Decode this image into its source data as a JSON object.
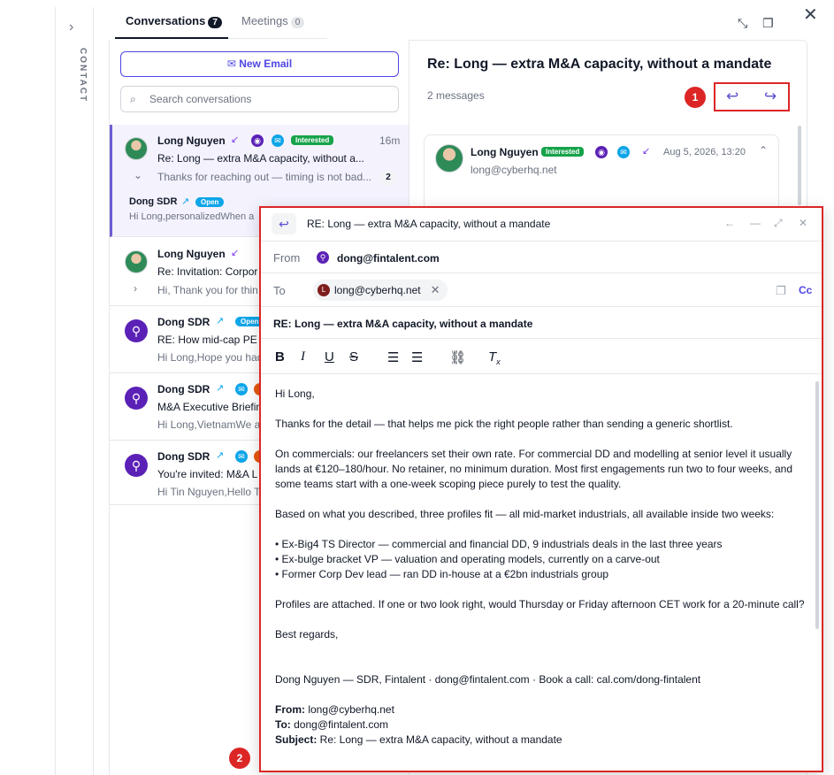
{
  "contact_rail": {
    "label": "CONTACT"
  },
  "tabs": [
    {
      "label": "Conversations",
      "count": "7"
    },
    {
      "label": "Meetings",
      "count": "0"
    }
  ],
  "list": {
    "new_email_label": "New Email",
    "search_placeholder": "Search conversations",
    "conversations": [
      {
        "name": "Long Nguyen",
        "tag": "Interested",
        "time": "16m",
        "subject": "Re: Long — extra M&A capacity, without a...",
        "preview": "Thanks for reaching out — timing is not bad...",
        "count": "2",
        "sub_name": "Dong SDR",
        "sub_badge": "Open",
        "sub_preview": "Hi Long,personalizedWhen a"
      },
      {
        "name": "Long Nguyen",
        "subject": "Re: Invitation: Corpor",
        "preview": "Hi, Thank you for thin"
      },
      {
        "name": "Dong SDR",
        "badge": "Open",
        "subject": "RE: How mid-cap PE",
        "preview": "Hi Long,Hope you had"
      },
      {
        "name": "Dong SDR",
        "subject": "M&A Executive Briefin",
        "preview": "Hi Long,VietnamWe a"
      },
      {
        "name": "Dong SDR",
        "subject": "You're invited: M&A L",
        "preview": "Hi Tin Nguyen,Hello T"
      }
    ]
  },
  "thread": {
    "title": "Re: Long — extra M&A capacity, without a mandate",
    "message_count": "2 messages",
    "annotation_1": "1",
    "message": {
      "sender": "Long Nguyen",
      "tag": "Interested",
      "date": "Aug 5, 2026, 13:20",
      "email": "long@cyberhq.net"
    }
  },
  "compose": {
    "title": "RE: Long — extra M&A capacity, without a mandate",
    "from_label": "From",
    "from_value": "dong@fintalent.com",
    "to_label": "To",
    "to_value": "long@cyberhq.net",
    "to_avatar": "L",
    "cc_label": "Cc",
    "subject": "RE: Long — extra M&A capacity, without a mandate",
    "annotation_2": "2",
    "body": {
      "greeting": "Hi Long,",
      "p1": "Thanks for the detail — that helps me pick the right people rather than sending a generic shortlist.",
      "p2": "On commercials: our freelancers set their own rate. For commercial DD and modelling at senior level it usually lands at €120–180/hour. No retainer, no minimum duration. Most first engagements run two to four weeks, and some teams start with a one-week scoping piece purely to test the quality.",
      "p3": "Based on what you described, three profiles fit — all mid-market industrials, all available inside two weeks:",
      "bullets": [
        "• Ex-Big4 TS Director — commercial and financial DD, 9 industrials deals in the last three years",
        "• Ex-bulge bracket VP — valuation and operating models, currently on a carve-out",
        "• Former Corp Dev lead — ran DD in-house at a €2bn industrials group"
      ],
      "p4": "Profiles are attached. If one or two look right, would Thursday or Friday afternoon CET work for a 20-minute call?",
      "closing": "Best regards,",
      "signature": "Dong Nguyen — SDR, Fintalent · dong@fintalent.com · Book a call: cal.com/dong-fintalent",
      "quoted_from_label": "From:",
      "quoted_from": " long@cyberhq.net",
      "quoted_to_label": "To:",
      "quoted_to": " dong@fintalent.com",
      "quoted_subject_label": "Subject:",
      "quoted_subject": " Re: Long — extra M&A capacity, without a mandate"
    }
  },
  "colors": {
    "accent": "#4f46e5",
    "highlight": "#dc2626",
    "interested": "#16a34a",
    "open": "#0ea5e9"
  }
}
